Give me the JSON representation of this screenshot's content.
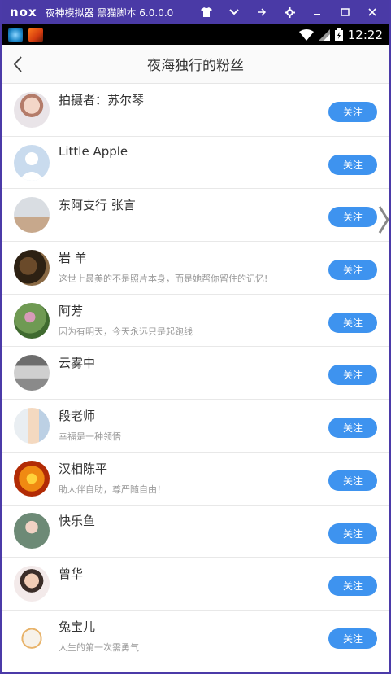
{
  "emulator": {
    "logo": "nox",
    "title": "夜神模拟器 黑猫脚本 6.0.0.0",
    "controls": [
      "👕",
      "⌄",
      "⇱",
      "⚙",
      "—",
      "☐",
      "✕"
    ]
  },
  "status_bar": {
    "time": "12:22"
  },
  "header": {
    "title": "夜海独行的粉丝",
    "back_icon": "back-arrow-icon"
  },
  "follow_label": "关注",
  "colors": {
    "accent": "#3e93ef",
    "emulator_bar": "#4a3aa6"
  },
  "fans": [
    {
      "name": "拍摄者：苏尔琴",
      "signature": "",
      "avatar": "photo-woman"
    },
    {
      "name": "Little Apple",
      "signature": "",
      "avatar": "default-silhouette"
    },
    {
      "name": "东阿支行 张言",
      "signature": "",
      "avatar": "photo-person"
    },
    {
      "name": "岩 羊",
      "signature": "这世上最美的不是照片本身，而是她帮你留住的记忆!",
      "avatar": "photo-goats"
    },
    {
      "name": "阿芳",
      "signature": "因为有明天，今天永远只是起跑线",
      "avatar": "photo-flowers"
    },
    {
      "name": "云雾中",
      "signature": "",
      "avatar": "photo-clouds"
    },
    {
      "name": "段老师",
      "signature": "幸福是一种领悟",
      "avatar": "photo-teacher"
    },
    {
      "name": "汉相陈平",
      "signature": "助人伴自助，尊严随自由！",
      "avatar": "photo-heart"
    },
    {
      "name": "快乐鱼",
      "signature": "",
      "avatar": "photo-girl"
    },
    {
      "name": "曾华",
      "signature": "",
      "avatar": "photo-woman2"
    },
    {
      "name": "兔宝儿",
      "signature": "人生的第一次需勇气",
      "avatar": "photo-bunny"
    }
  ]
}
